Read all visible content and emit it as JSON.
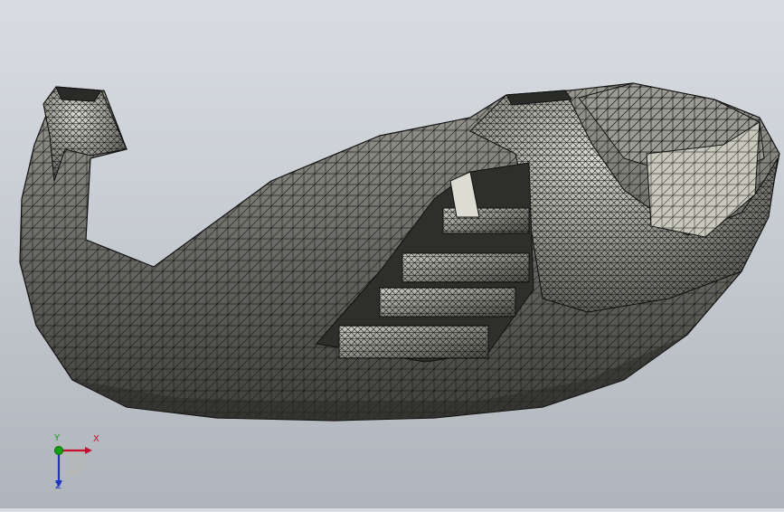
{
  "viewport": {
    "model_icon": "boat-mesh-model",
    "display_mode": "shaded-with-edges"
  },
  "triad": {
    "x_label": "X",
    "y_label": "Y",
    "z_label": "Z",
    "colors": {
      "x": "#c8102e",
      "y": "#12a012",
      "z": "#2233bb"
    }
  }
}
